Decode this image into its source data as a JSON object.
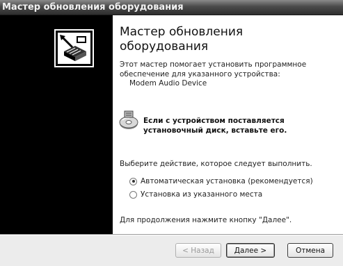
{
  "window": {
    "title": "Мастер обновления оборудования"
  },
  "left_panel": {
    "logo_icon": "hardware-wizard-icon"
  },
  "main": {
    "heading": "Мастер обновления оборудования",
    "intro": "Этот мастер помогает установить программное обеспечение для указанного устройства:",
    "device_name": "Modem Audio Device",
    "cd_icon": "cd-disc-icon",
    "cd_note": "Если с устройством поставляется установочный диск, вставьте его.",
    "prompt": "Выберите действие, которое следует выполнить.",
    "options": [
      {
        "label": "Автоматическая установка (рекомендуется)",
        "checked": true
      },
      {
        "label": "Установка из указанного места",
        "checked": false
      }
    ],
    "continue_hint": "Для продолжения нажмите кнопку \"Далее\"."
  },
  "buttons": {
    "back": "< Назад",
    "next": "Далее >",
    "cancel": "Отмена"
  }
}
